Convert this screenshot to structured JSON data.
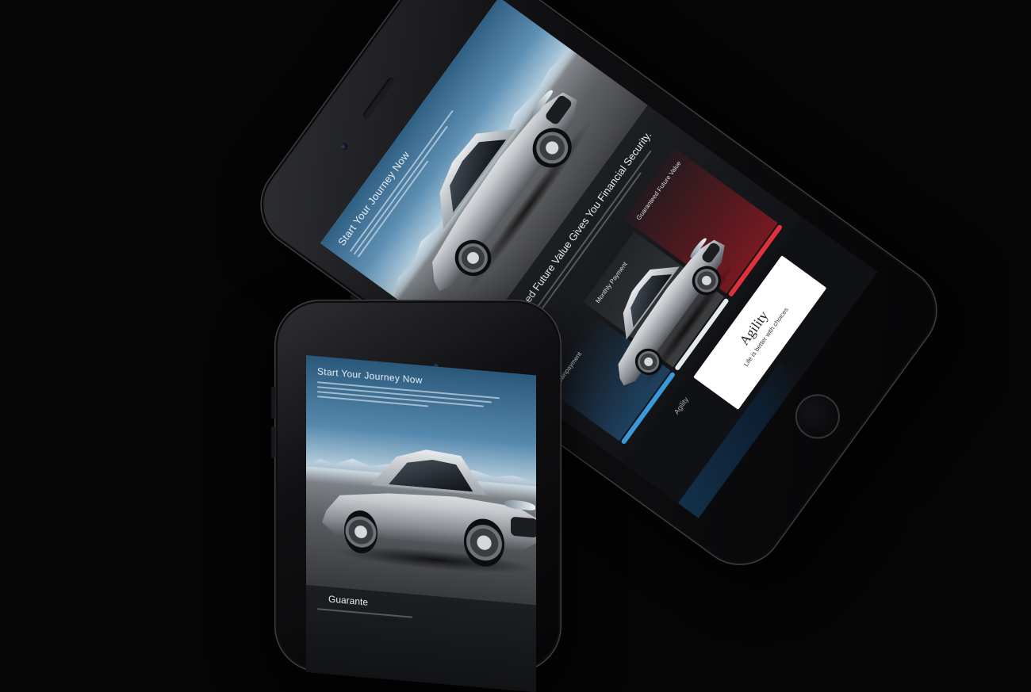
{
  "large_phone": {
    "hero_title": "Start Your Journey Now",
    "section_title": "Guaranteed Future Value Gives You Financial Security.",
    "columns": [
      {
        "label": "Downpayment",
        "color": "#3a9ad9"
      },
      {
        "label": "Monthly Payment",
        "color": "#e6e8ea"
      },
      {
        "label": "Guaranteed Future Value",
        "color": "#e0303c"
      }
    ],
    "tab_label": "Agility",
    "card": {
      "title": "Agility",
      "subtitle": "Life is better with choices"
    }
  },
  "small_phone": {
    "hero_title": "Start Your Journey Now",
    "bottom_heading": "Guarante"
  },
  "colors": {
    "background": "#050505",
    "accent_blue": "#3a9ad9",
    "accent_red": "#e0303c"
  }
}
